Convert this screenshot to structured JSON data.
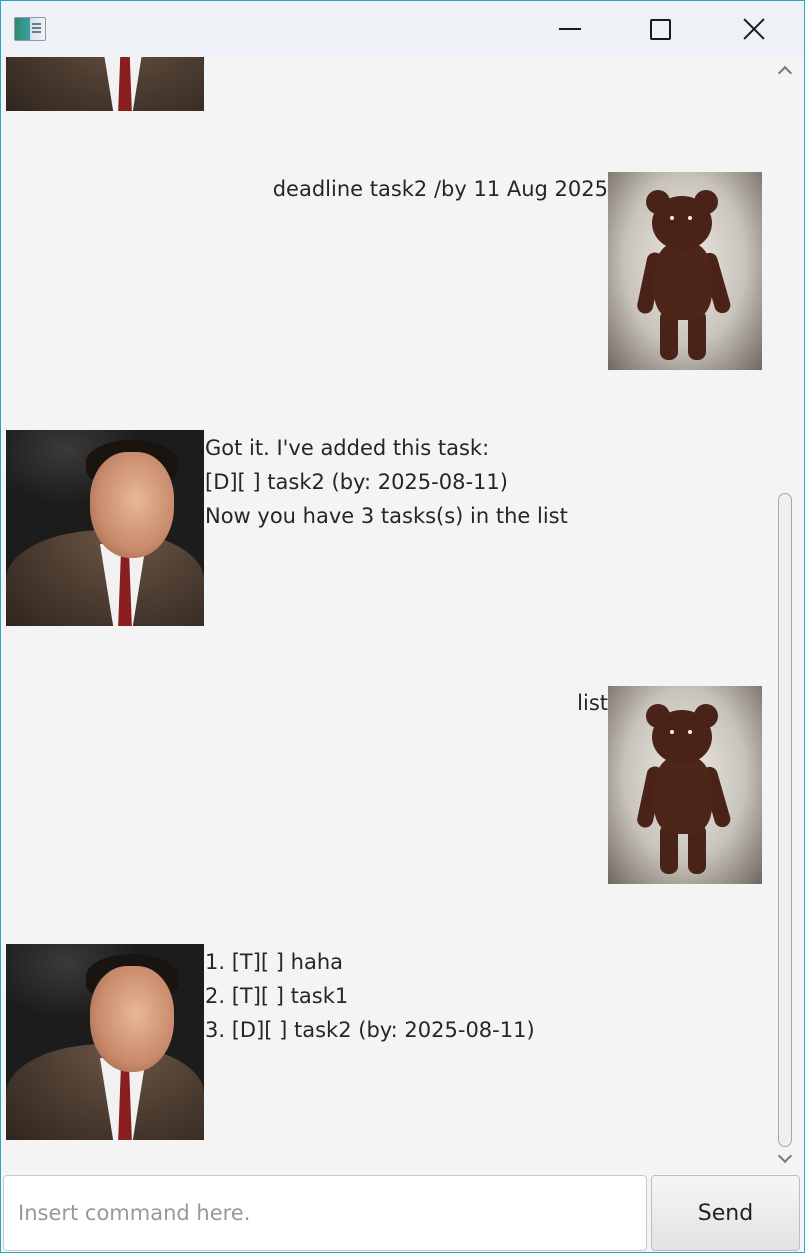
{
  "window": {
    "minimize_icon": "minimize-icon",
    "maximize_icon": "maximize-icon",
    "close_icon": "close-icon",
    "border_color": "#2aa3c9"
  },
  "chat": {
    "messages": [
      {
        "sender": "user",
        "avatar": "teddy-bear-avatar",
        "text": "deadline task2 /by 11 Aug 2025"
      },
      {
        "sender": "bot",
        "avatar": "man-in-suit-avatar",
        "lines": [
          "Got it. I've added this task:",
          "[D][ ] task2 (by: 2025-08-11)",
          "Now you have 3 tasks(s) in the list"
        ]
      },
      {
        "sender": "user",
        "avatar": "teddy-bear-avatar",
        "text": "list"
      },
      {
        "sender": "bot",
        "avatar": "man-in-suit-avatar",
        "lines": [
          "1. [T][ ] haha",
          "2. [T][ ] task1",
          "3. [D][ ] task2 (by: 2025-08-11)"
        ]
      }
    ]
  },
  "input": {
    "placeholder": "Insert command here.",
    "value": ""
  },
  "send_button": {
    "label": "Send"
  }
}
